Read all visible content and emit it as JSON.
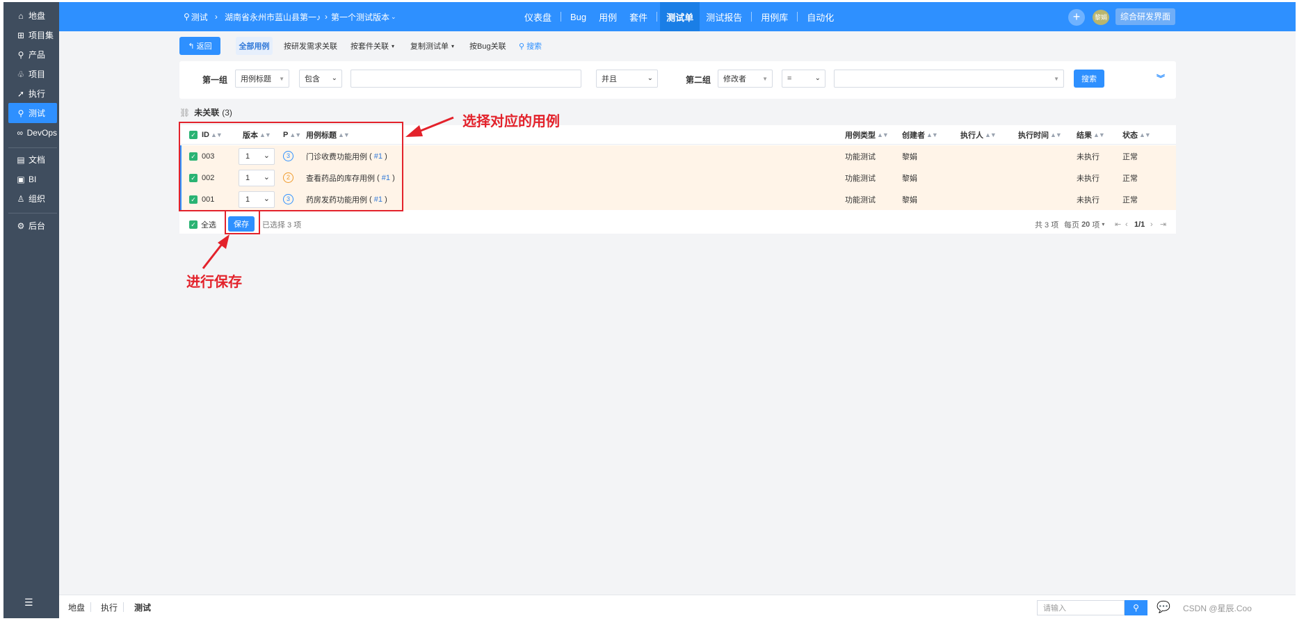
{
  "sidebar": {
    "items": [
      {
        "label": "地盘",
        "icon": "home-icon",
        "glyph": "⌂"
      },
      {
        "label": "项目集",
        "icon": "grid-icon",
        "glyph": "⊞"
      },
      {
        "label": "产品",
        "icon": "lightbulb-icon",
        "glyph": "⚲"
      },
      {
        "label": "项目",
        "icon": "bell-icon",
        "glyph": "♧"
      },
      {
        "label": "执行",
        "icon": "run-icon",
        "glyph": "➚"
      },
      {
        "label": "测试",
        "icon": "search-icon",
        "glyph": "⚲"
      },
      {
        "label": "DevOps",
        "icon": "infinity-icon",
        "glyph": "∞"
      },
      {
        "label": "文档",
        "icon": "document-icon",
        "glyph": "▤"
      },
      {
        "label": "BI",
        "icon": "chart-icon",
        "glyph": "▣"
      },
      {
        "label": "组织",
        "icon": "people-icon",
        "glyph": "♙"
      },
      {
        "label": "后台",
        "icon": "gear-icon",
        "glyph": "⚙"
      }
    ],
    "collapse_icon": "menu-collapse-icon"
  },
  "header": {
    "crumb_module": "测试",
    "crumb_project": "湖南省永州市蓝山县第一♪",
    "crumb_build": "第一个测试版本",
    "menu": [
      "仪表盘",
      "Bug",
      "用例",
      "套件",
      "测试单",
      "测试报告",
      "用例库",
      "自动化"
    ],
    "active_menu": "测试单",
    "avatar_text": "黎娟",
    "workspace_label": "综合研发界面"
  },
  "toolbar": {
    "back_label": "返回",
    "tab_all": "全部用例",
    "link_story": "按研发需求关联",
    "link_suite": "按套件关联",
    "link_copy": "复制测试单",
    "link_bug": "按Bug关联",
    "link_search": "搜索"
  },
  "search": {
    "group1_label": "第一组",
    "group1_field": "用例标题",
    "group1_op": "包含",
    "group1_value": "",
    "relation": "并且",
    "group2_label": "第二组",
    "group2_field": "修改者",
    "group2_op": "=",
    "group2_value": "",
    "search_button": "搜索"
  },
  "list": {
    "title": "未关联",
    "count": "(3)",
    "columns": {
      "id": "ID",
      "version": "版本",
      "priority": "P",
      "title": "用例标题",
      "type": "用例类型",
      "creator": "创建者",
      "executor": "执行人",
      "exec_time": "执行时间",
      "result": "结果",
      "status": "状态"
    },
    "rows": [
      {
        "id": "003",
        "version": "1",
        "priority": "3",
        "title": "门诊收费功能用例",
        "ref": "#1",
        "type": "功能测试",
        "creator": "黎娟",
        "executor": "",
        "exec_time": "",
        "result": "未执行",
        "status": "正常"
      },
      {
        "id": "002",
        "version": "1",
        "priority": "2",
        "title": "查看药品的库存用例",
        "ref": "#1",
        "type": "功能测试",
        "creator": "黎娟",
        "executor": "",
        "exec_time": "",
        "result": "未执行",
        "status": "正常"
      },
      {
        "id": "001",
        "version": "1",
        "priority": "3",
        "title": "药房发药功能用例",
        "ref": "#1",
        "type": "功能测试",
        "creator": "黎娟",
        "executor": "",
        "exec_time": "",
        "result": "未执行",
        "status": "正常"
      }
    ],
    "footer": {
      "select_all": "全选",
      "save": "保存",
      "selected": "已选择 3 项",
      "total": "共 3 项",
      "per_page_label": "每页",
      "per_page": "20",
      "per_page_unit": "项",
      "page": "1/1"
    }
  },
  "annotations": {
    "select_cases": "选择对应的用例",
    "save_note": "进行保存",
    "color": "#e3222b"
  },
  "bottombar": {
    "items": [
      "地盘",
      "执行",
      "测试"
    ],
    "active": "测试",
    "search_placeholder": "请输入",
    "watermark": "CSDN @星辰.Coo"
  },
  "colors": {
    "primary": "#2e90ff",
    "sidebar": "#3f4d5e",
    "row_highlight": "#fff4e8",
    "check": "#2ab373"
  }
}
